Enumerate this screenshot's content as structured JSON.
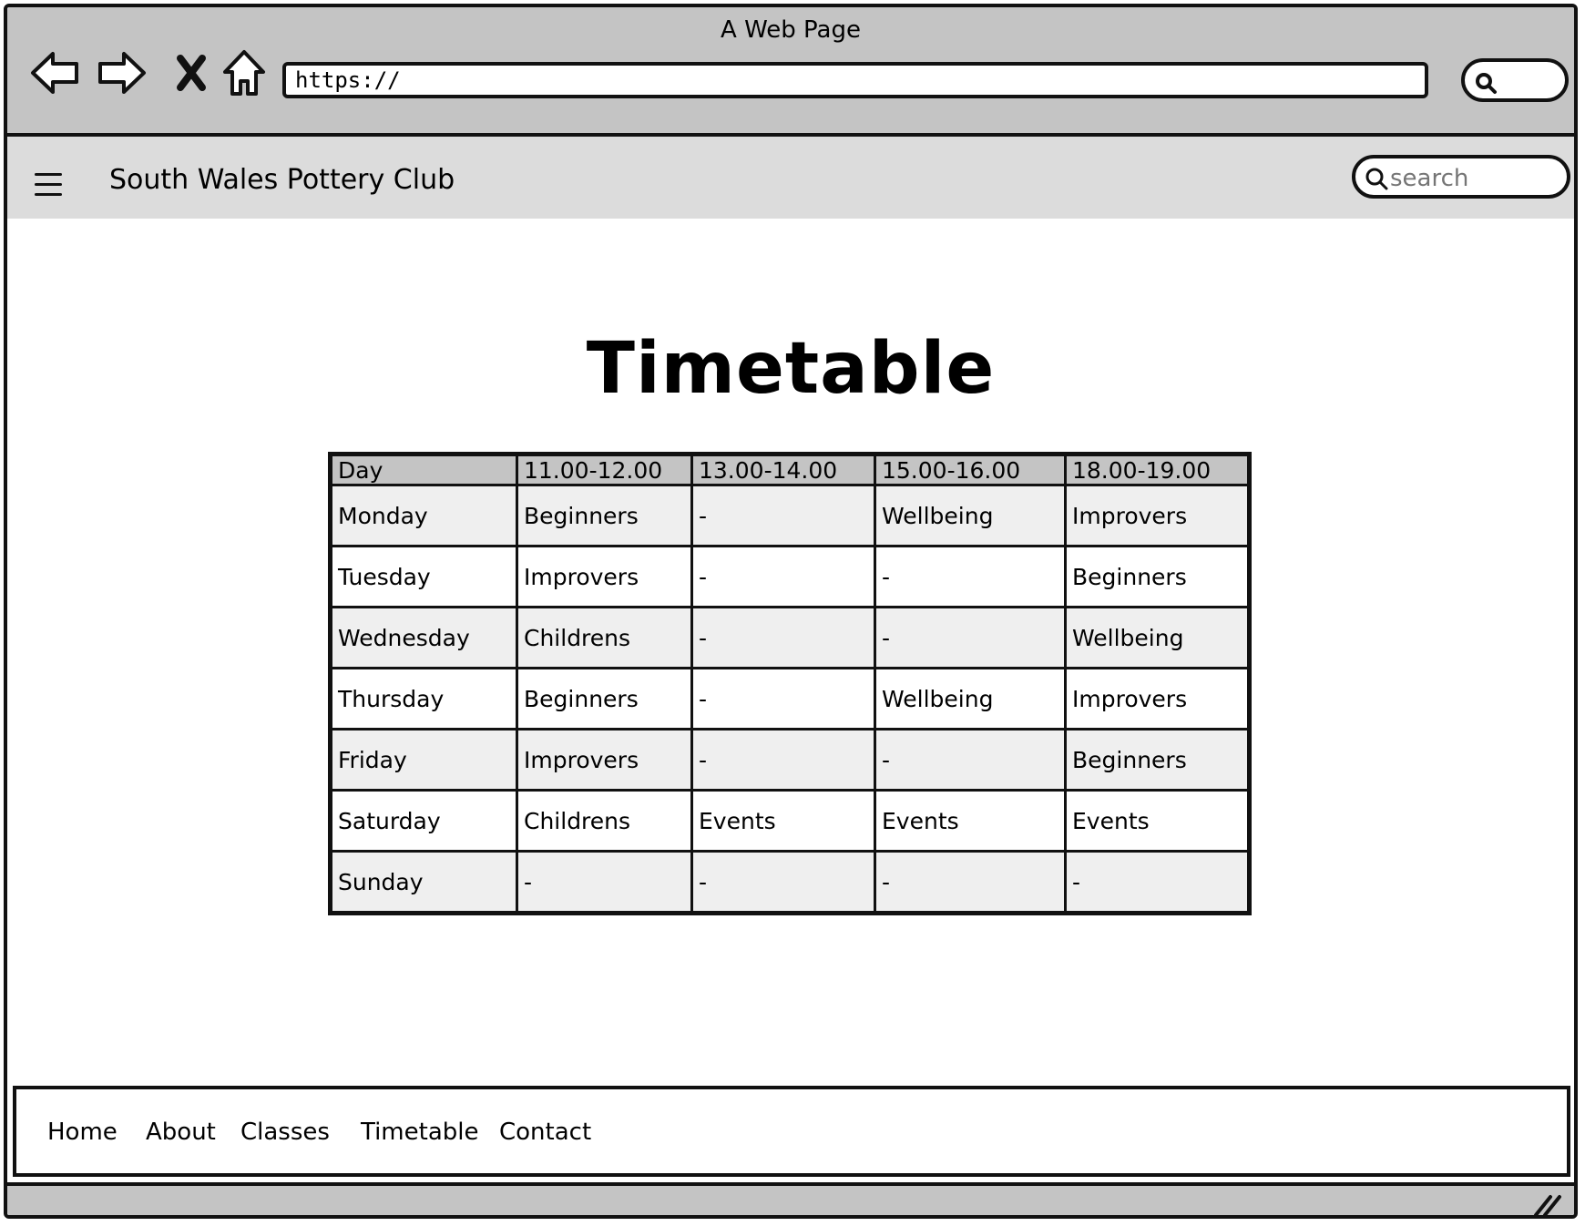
{
  "window": {
    "title": "A Web Page"
  },
  "address_bar": {
    "url": "https://"
  },
  "site": {
    "title": "South Wales Pottery Club",
    "search_placeholder": "search"
  },
  "page": {
    "heading": "Timetable"
  },
  "timetable": {
    "headers": [
      "Day",
      "11.00-12.00",
      "13.00-14.00",
      "15.00-16.00",
      "18.00-19.00"
    ],
    "rows": [
      [
        "Monday",
        "Beginners",
        "-",
        "Wellbeing",
        "Improvers"
      ],
      [
        "Tuesday",
        "Improvers",
        "-",
        "-",
        "Beginners"
      ],
      [
        "Wednesday",
        "Childrens",
        "-",
        "-",
        "Wellbeing"
      ],
      [
        "Thursday",
        "Beginners",
        "-",
        "Wellbeing",
        "Improvers"
      ],
      [
        "Friday",
        "Improvers",
        "-",
        "-",
        "Beginners"
      ],
      [
        "Saturday",
        "Childrens",
        "Events",
        "Events",
        "Events"
      ],
      [
        "Sunday",
        "-",
        "-",
        "-",
        "-"
      ]
    ]
  },
  "footer": {
    "links": [
      "Home",
      "About",
      "Classes",
      "Timetable",
      "Contact"
    ]
  },
  "icons": {
    "back": "back-arrow-icon",
    "forward": "forward-arrow-icon",
    "stop": "close-icon",
    "home": "home-icon",
    "search": "search-icon",
    "menu": "hamburger-menu-icon",
    "resize": "resize-grip-icon"
  },
  "colors": {
    "chrome": "#c4c4c4",
    "site_bar": "#dcdcdc",
    "row_shaded": "#efefef",
    "border": "#111111"
  }
}
